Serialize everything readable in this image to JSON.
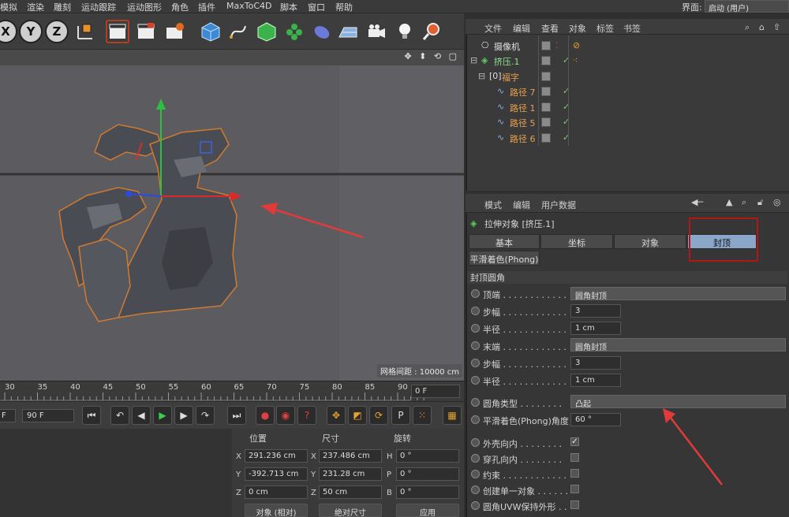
{
  "menubar": {
    "items": [
      "模拟",
      "渲染",
      "雕刻",
      "运动跟踪",
      "运动图形",
      "角色",
      "插件",
      "MaxToC4D",
      "脚本",
      "窗口",
      "帮助"
    ],
    "layout_label": "界面:",
    "layout_value": "启动 (用户)"
  },
  "toolbar": {
    "axes": [
      "X",
      "Y",
      "Z"
    ]
  },
  "viewport": {
    "grid_label": "网格间距 : 10000 cm",
    "model_char": "福"
  },
  "timeline": {
    "ticks": [
      "30",
      "35",
      "40",
      "45",
      "50",
      "55",
      "60",
      "65",
      "70",
      "75",
      "80",
      "85",
      "90"
    ],
    "frame_value": "0 F"
  },
  "transport": {
    "end_frame": "90 F",
    "left_value": "F"
  },
  "coords": {
    "headers": [
      "位置",
      "尺寸",
      "旋转"
    ],
    "rows": [
      {
        "axis": "X",
        "pos": "291.236 cm",
        "size_axis": "X",
        "size": "237.486 cm",
        "rot_axis": "H",
        "rot": "0 °"
      },
      {
        "axis": "Y",
        "pos": "-392.713 cm",
        "size_axis": "Y",
        "size": "231.28 cm",
        "rot_axis": "P",
        "rot": "0 °"
      },
      {
        "axis": "Z",
        "pos": "0 cm",
        "size_axis": "Z",
        "size": "50 cm",
        "rot_axis": "B",
        "rot": "0 °"
      }
    ],
    "mode_select": "对象 (相对)",
    "size_mode": "绝对尺寸",
    "apply": "应用"
  },
  "object_manager": {
    "menu": [
      "文件",
      "编辑",
      "查看",
      "对象",
      "标签",
      "书签"
    ],
    "objects": [
      {
        "name": "摄像机",
        "color": "#e0e0e0"
      },
      {
        "name": "挤压.1",
        "color": "#8fe08f"
      },
      {
        "name": "福字",
        "color": "#e8a050"
      },
      {
        "name": "路径 7",
        "color": "#e8a050"
      },
      {
        "name": "路径 1",
        "color": "#e8a050"
      },
      {
        "name": "路径 5",
        "color": "#e8a050"
      },
      {
        "name": "路径 6",
        "color": "#e8a050"
      }
    ]
  },
  "attributes": {
    "menu": [
      "模式",
      "编辑",
      "用户数据"
    ],
    "title": "拉伸对象 [挤压.1]",
    "tabs": [
      "基本",
      "坐标",
      "对象",
      "封顶"
    ],
    "tab2": "平滑着色(Phong)",
    "section": "封顶圆角",
    "params": [
      {
        "label": "顶端 . . . . . . . . . . . .",
        "value": "圆角封顶",
        "kind": "select"
      },
      {
        "label": "步幅 . . . . . . . . . . . .",
        "value": "3",
        "kind": "field"
      },
      {
        "label": "半径 . . . . . . . . . . . .",
        "value": "1 cm",
        "kind": "field"
      },
      {
        "label": "末端 . . . . . . . . . . . .",
        "value": "圆角封顶",
        "kind": "select"
      },
      {
        "label": "步幅 . . . . . . . . . . . .",
        "value": "3",
        "kind": "field"
      },
      {
        "label": "半径 . . . . . . . . . . . .",
        "value": "1 cm",
        "kind": "field"
      }
    ],
    "round_type_label": "圆角类型 . . . . . . . .",
    "round_type_value": "凸起",
    "phong_label": "平滑着色(Phong)角度",
    "phong_value": "60 °",
    "checks": [
      {
        "label": "外壳向内 . . . . . . . .",
        "checked": "✓"
      },
      {
        "label": "穿孔向内 . . . . . . . .",
        "checked": ""
      },
      {
        "label": "约束 . . . . . . . . . . . .",
        "checked": ""
      },
      {
        "label": "创建单一对象 . . . . . .",
        "checked": ""
      },
      {
        "label": "圆角UVW保持外形 . .",
        "checked": ""
      }
    ]
  },
  "colors": {
    "highlight_box": "#b01818",
    "active_tab": "#8aa6c8",
    "arrow": "#e03a3a"
  }
}
